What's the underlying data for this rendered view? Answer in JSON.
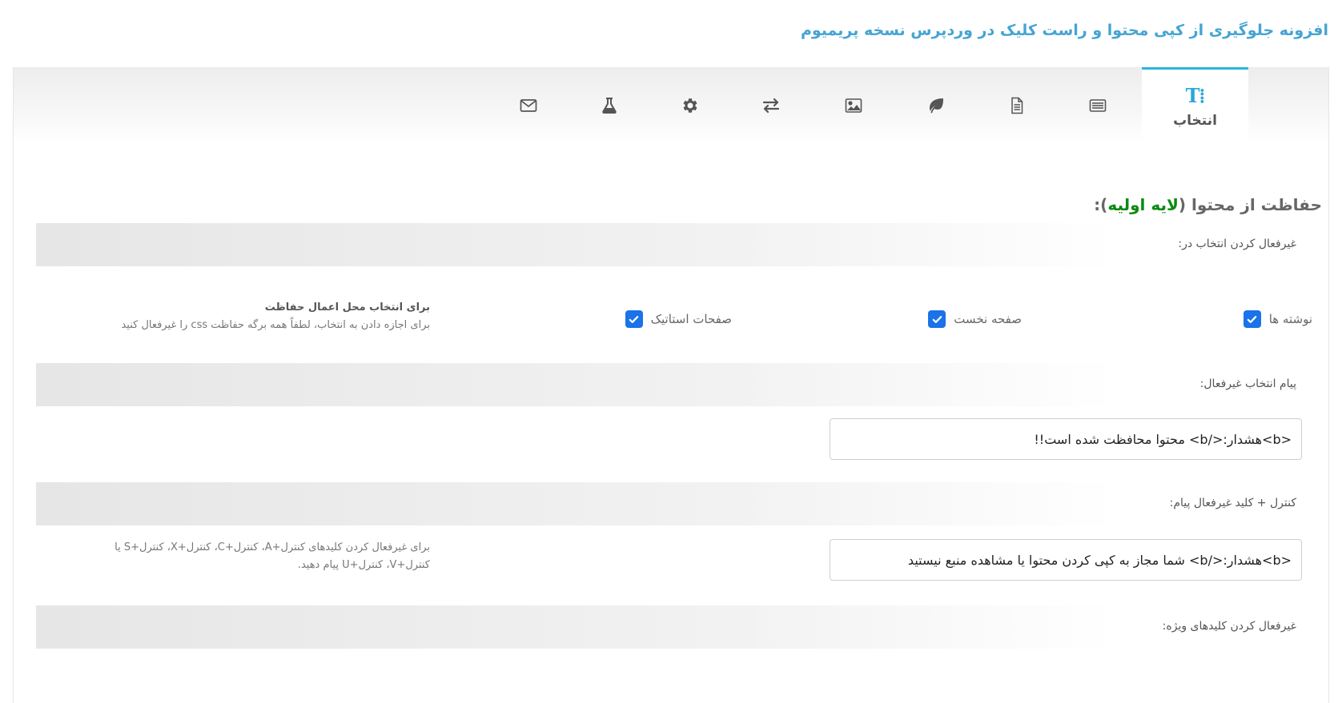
{
  "page": {
    "title": "افزونه جلوگیری از کپی محتوا و راست کلیک در وردپرس نسخه پریمیوم"
  },
  "tabs": [
    {
      "id": "selection",
      "icon": "text-select-icon",
      "label": "انتخاب",
      "active": true
    },
    {
      "id": "list",
      "icon": "list-icon"
    },
    {
      "id": "document",
      "icon": "document-icon"
    },
    {
      "id": "leaf",
      "icon": "leaf-icon"
    },
    {
      "id": "image",
      "icon": "image-icon"
    },
    {
      "id": "transfer",
      "icon": "transfer-arrows-icon"
    },
    {
      "id": "settings",
      "icon": "gear-icon"
    },
    {
      "id": "lab",
      "icon": "flask-icon"
    },
    {
      "id": "mail",
      "icon": "mail-icon"
    }
  ],
  "section": {
    "title_prefix": "حفاظت از محتوا (",
    "title_highlight": "لایه اولیه",
    "title_suffix": "):"
  },
  "disable_selection": {
    "label": "غیرفعال کردن انتخاب در:",
    "options": [
      {
        "label": "نوشته ها",
        "checked": true
      },
      {
        "label": "صفحه نخست",
        "checked": true
      },
      {
        "label": "صفحات استاتیک",
        "checked": true
      }
    ],
    "help_title": "برای انتخاب محل اعمال حفاظت",
    "help_text": "برای اجازه دادن به انتخاب، لطفاً همه برگه حفاظت css را غیرفعال کنید"
  },
  "selection_message": {
    "label": "پیام انتخاب غیرفعال:",
    "value": "<b>هشدار:</b> محتوا محافظت شده است!!"
  },
  "ctrl_message": {
    "label": "کنترل + کلید غیرفعال پیام:",
    "value": "<b>هشدار:</b> شما مجاز به کپی کردن محتوا یا مشاهده منبع نیستید",
    "help_line1": "برای غیرفعال کردن کلیدهای کنترل+A، کنترل+C، کنترل+X، کنترل+S یا",
    "help_line2": "کنترل+V، کنترل+U پیام دهید."
  },
  "special_keys": {
    "label": "غیرفعال کردن کلیدهای ویژه:"
  },
  "colors": {
    "accent": "#29b6d8",
    "title": "#45a4d3",
    "highlight": "#0c8a12",
    "checkbox": "#1a73e8"
  }
}
